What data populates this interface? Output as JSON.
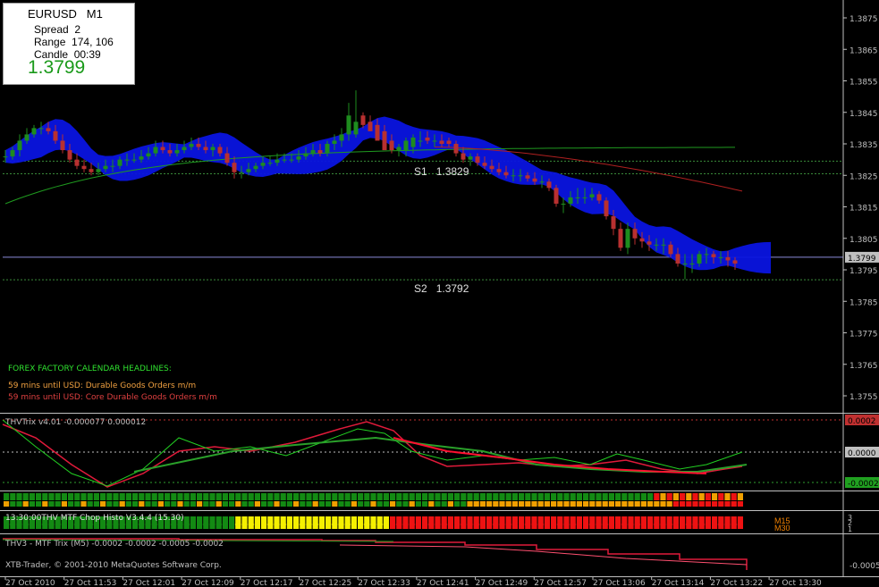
{
  "colors": {
    "background": "#000000",
    "bull": "#1e8c1e",
    "bear": "#b83030",
    "cloud": "#0a14e0",
    "grid_line": "#3a8a3a",
    "trix_green": "#22d022",
    "trix_red": "#e01a3a",
    "heat_green": "#138a13",
    "heat_yellow": "#f5f000",
    "heat_red": "#ee1212",
    "heat_orange": "#f0a000"
  },
  "info_box": {
    "symbol": "EURUSD",
    "timeframe": "M1",
    "spread_label": "Spread",
    "spread_value": "2",
    "range_label": "Range",
    "range_value": "174, 106",
    "candle_label": "Candle",
    "candle_value": "00:39",
    "price": "1.3799"
  },
  "levels": {
    "s1_label": "S1",
    "s1_value": "1.3829",
    "s2_label": "S2",
    "s2_value": "1.3792"
  },
  "news": {
    "title": "FOREX FACTORY CALENDAR  HEADLINES:",
    "line1": "59 mins until USD: Durable Goods Orders m/m",
    "line2": "59 mins until USD: Core Durable Goods Orders m/m"
  },
  "indicators": {
    "trix_title": "THVTrix v4.01 -0.000077 0.000012",
    "heatmap2_title": "13:30:00THV MTF Chop Histo V3.4.4 (15.30)",
    "trix_m5_title": "THV3 - MTF Trix (M5) -0.0002 -0.0002 -0.0005 -0.0002",
    "copyright": "XTB-Trader, © 2001-2010 MetaQuotes Software Corp.",
    "m15_label": "M15",
    "m30_label": "M30"
  },
  "axis": {
    "price_ticks": [
      "1.3875",
      "1.3865",
      "1.3855",
      "1.3845",
      "1.3835",
      "1.3825",
      "1.3815",
      "1.3805",
      "1.3795",
      "1.3785",
      "1.3775",
      "1.3765",
      "1.3755"
    ],
    "current_price_tag": "1.3799",
    "trix_ticks": [
      "0.0002",
      "0.0000",
      "-0.0002"
    ],
    "heat_ticks": [
      "3",
      "2",
      "1"
    ],
    "trix_m5_ticks": [
      "-0.0005"
    ],
    "time_ticks": [
      "27 Oct 2010",
      "27 Oct 11:53",
      "27 Oct 12:01",
      "27 Oct 12:09",
      "27 Oct 12:17",
      "27 Oct 12:25",
      "27 Oct 12:33",
      "27 Oct 12:41",
      "27 Oct 12:49",
      "27 Oct 12:57",
      "27 Oct 13:06",
      "27 Oct 13:14",
      "27 Oct 13:22",
      "27 Oct 13:30"
    ]
  },
  "chart_data": {
    "type": "candlestick",
    "symbol": "EURUSD",
    "timeframe": "M1",
    "ylim": [
      1.375,
      1.388
    ],
    "x": [
      "11:45",
      "11:46",
      "11:47",
      "11:48",
      "11:49",
      "11:50",
      "11:51",
      "11:52",
      "11:53",
      "11:54",
      "11:55",
      "11:56",
      "11:57",
      "11:58",
      "11:59",
      "12:00",
      "12:01",
      "12:02",
      "12:03",
      "12:04",
      "12:05",
      "12:06",
      "12:07",
      "12:08",
      "12:09",
      "12:10",
      "12:11",
      "12:12",
      "12:13",
      "12:14",
      "12:15",
      "12:16",
      "12:17",
      "12:18",
      "12:19",
      "12:20",
      "12:21",
      "12:22",
      "12:23",
      "12:24",
      "12:25",
      "12:26",
      "12:27",
      "12:28",
      "12:29",
      "12:30",
      "12:31",
      "12:32",
      "12:33",
      "12:34",
      "12:35",
      "12:36",
      "12:37",
      "12:38",
      "12:39",
      "12:40",
      "12:41",
      "12:42",
      "12:43",
      "12:44",
      "12:45",
      "12:46",
      "12:47",
      "12:48",
      "12:49",
      "12:50",
      "12:51",
      "12:52",
      "12:53",
      "12:54",
      "12:55",
      "12:56",
      "12:57",
      "12:58",
      "12:59",
      "13:00",
      "13:01",
      "13:02",
      "13:03",
      "13:04",
      "13:05",
      "13:06",
      "13:07",
      "13:08",
      "13:09",
      "13:10",
      "13:11",
      "13:12",
      "13:13",
      "13:14",
      "13:15",
      "13:16",
      "13:17",
      "13:18",
      "13:19",
      "13:20",
      "13:21",
      "13:22",
      "13:23",
      "13:24",
      "13:25",
      "13:26",
      "13:27"
    ],
    "open": [
      1.3831,
      1.3831,
      1.3833,
      1.3836,
      1.3838,
      1.384,
      1.384,
      1.3839,
      1.3836,
      1.3833,
      1.383,
      1.3828,
      1.3827,
      1.3826,
      1.3827,
      1.3828,
      1.3828,
      1.383,
      1.383,
      1.383,
      1.3831,
      1.3832,
      1.3834,
      1.3833,
      1.3832,
      1.3833,
      1.3834,
      1.3835,
      1.3834,
      1.3833,
      1.3834,
      1.3832,
      1.3829,
      1.3826,
      1.3826,
      1.3827,
      1.3828,
      1.3829,
      1.3829,
      1.383,
      1.383,
      1.383,
      1.3831,
      1.3832,
      1.3833,
      1.3832,
      1.3835,
      1.3836,
      1.3838,
      1.3838,
      1.3844,
      1.3842,
      1.3841,
      1.3839,
      1.3836,
      1.3833,
      1.3833,
      1.3834,
      1.3836,
      1.3837,
      1.3836,
      1.3836,
      1.3836,
      1.3835,
      1.3832,
      1.383,
      1.3831,
      1.3829,
      1.3828,
      1.3827,
      1.3826,
      1.3825,
      1.3825,
      1.3825,
      1.3824,
      1.3823,
      1.3823,
      1.3821,
      1.3816,
      1.3816,
      1.3818,
      1.3818,
      1.3818,
      1.3819,
      1.3817,
      1.3812,
      1.3808,
      1.3802,
      1.3808,
      1.3805,
      1.3804,
      1.3803,
      1.3803,
      1.3803,
      1.38,
      1.3797,
      1.3797,
      1.3797,
      1.38,
      1.38,
      1.3799,
      1.3799,
      1.3798
    ],
    "high": [
      1.3833,
      1.3834,
      1.3838,
      1.384,
      1.3841,
      1.3842,
      1.3842,
      1.3841,
      1.3838,
      1.3835,
      1.3832,
      1.383,
      1.3829,
      1.3829,
      1.383,
      1.383,
      1.3831,
      1.3832,
      1.3832,
      1.3833,
      1.3834,
      1.3836,
      1.3836,
      1.3835,
      1.3835,
      1.3836,
      1.3837,
      1.3837,
      1.3836,
      1.3835,
      1.3835,
      1.3834,
      1.3831,
      1.3828,
      1.3829,
      1.3829,
      1.3831,
      1.3831,
      1.3832,
      1.3832,
      1.3832,
      1.3833,
      1.3834,
      1.3835,
      1.3835,
      1.3836,
      1.3838,
      1.384,
      1.3848,
      1.3852,
      1.3845,
      1.3844,
      1.3843,
      1.3841,
      1.3838,
      1.3835,
      1.3837,
      1.3838,
      1.3839,
      1.3839,
      1.3838,
      1.3838,
      1.3837,
      1.3836,
      1.3834,
      1.3832,
      1.3832,
      1.3831,
      1.383,
      1.3829,
      1.3828,
      1.3827,
      1.3827,
      1.3826,
      1.3826,
      1.3825,
      1.3824,
      1.3822,
      1.3818,
      1.382,
      1.3821,
      1.3821,
      1.3821,
      1.382,
      1.3818,
      1.3814,
      1.381,
      1.381,
      1.381,
      1.3807,
      1.3806,
      1.3805,
      1.3805,
      1.3804,
      1.3802,
      1.38,
      1.38,
      1.3801,
      1.3802,
      1.3801,
      1.3801,
      1.3801,
      1.3799
    ],
    "low": [
      1.3829,
      1.383,
      1.3831,
      1.3835,
      1.3837,
      1.3838,
      1.3838,
      1.3835,
      1.3832,
      1.3829,
      1.3827,
      1.3826,
      1.3825,
      1.3825,
      1.3826,
      1.3826,
      1.3827,
      1.3828,
      1.3829,
      1.3829,
      1.383,
      1.3831,
      1.3832,
      1.3831,
      1.3831,
      1.3832,
      1.3833,
      1.3833,
      1.3832,
      1.3831,
      1.3831,
      1.3828,
      1.3824,
      1.3824,
      1.3825,
      1.3826,
      1.3827,
      1.3828,
      1.3828,
      1.3829,
      1.3829,
      1.3829,
      1.383,
      1.3831,
      1.3831,
      1.3831,
      1.3833,
      1.3834,
      1.3836,
      1.3837,
      1.384,
      1.3839,
      1.3838,
      1.3835,
      1.3832,
      1.3831,
      1.3831,
      1.3832,
      1.3834,
      1.3835,
      1.3834,
      1.3834,
      1.3834,
      1.3831,
      1.3829,
      1.3828,
      1.3828,
      1.3827,
      1.3826,
      1.3825,
      1.3824,
      1.3823,
      1.3823,
      1.3823,
      1.3822,
      1.3821,
      1.382,
      1.3815,
      1.3813,
      1.3815,
      1.3816,
      1.3816,
      1.3817,
      1.3816,
      1.3811,
      1.3806,
      1.3801,
      1.38,
      1.3803,
      1.3802,
      1.3801,
      1.3801,
      1.38,
      1.3799,
      1.3796,
      1.3792,
      1.3794,
      1.3796,
      1.3797,
      1.3797,
      1.3797,
      1.3796,
      1.3795
    ],
    "close": [
      1.3831,
      1.3833,
      1.3836,
      1.3838,
      1.384,
      1.384,
      1.3839,
      1.3836,
      1.3833,
      1.383,
      1.3828,
      1.3827,
      1.3826,
      1.3827,
      1.3828,
      1.3828,
      1.383,
      1.383,
      1.383,
      1.3831,
      1.3832,
      1.3834,
      1.3833,
      1.3832,
      1.3833,
      1.3834,
      1.3835,
      1.3834,
      1.3833,
      1.3834,
      1.3832,
      1.3829,
      1.3826,
      1.3826,
      1.3827,
      1.3828,
      1.3829,
      1.3829,
      1.383,
      1.383,
      1.383,
      1.3831,
      1.3832,
      1.3833,
      1.3832,
      1.3835,
      1.3836,
      1.3838,
      1.3844,
      1.3842,
      1.3841,
      1.3839,
      1.3836,
      1.3833,
      1.3833,
      1.3834,
      1.3836,
      1.3837,
      1.3836,
      1.3836,
      1.3836,
      1.3835,
      1.3835,
      1.3832,
      1.383,
      1.3831,
      1.3829,
      1.3828,
      1.3827,
      1.3826,
      1.3825,
      1.3825,
      1.3825,
      1.3824,
      1.3823,
      1.3823,
      1.3821,
      1.3816,
      1.3816,
      1.3818,
      1.3818,
      1.3818,
      1.3819,
      1.3817,
      1.3812,
      1.3808,
      1.3802,
      1.3808,
      1.3805,
      1.3804,
      1.3803,
      1.3803,
      1.3803,
      1.38,
      1.3797,
      1.3797,
      1.3797,
      1.38,
      1.38,
      1.3799,
      1.3799,
      1.3798,
      1.3797
    ]
  }
}
